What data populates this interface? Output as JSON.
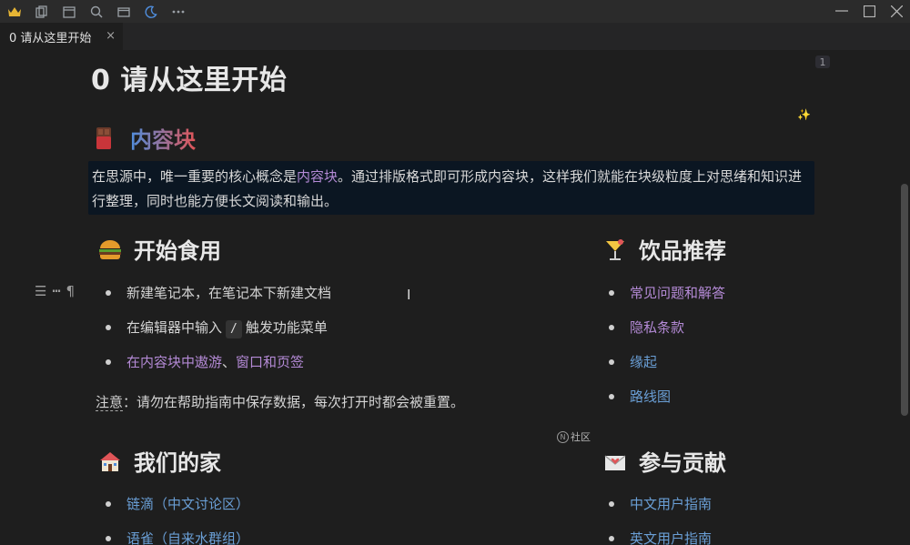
{
  "toolbar": {
    "icons": [
      "crown-icon",
      "copy-icon",
      "calendar-icon",
      "search-icon",
      "window-icon",
      "moon-icon",
      "more-icon"
    ]
  },
  "window_controls": [
    "minimize-icon",
    "maximize-icon",
    "close-icon"
  ],
  "tab": {
    "label": "0 请从这里开始",
    "close": "×"
  },
  "page": {
    "title": "0 请从这里开始",
    "badge": "1"
  },
  "section_content_block": {
    "title": "内容块",
    "quote_before": "在思源中，唯一重要的核心概念是",
    "quote_link": "内容块",
    "quote_after": "。通过排版格式即可形成内容块，这样我们就能在块级粒度上对思绪和知识进行整理，同时也能方便长文阅读和输出。"
  },
  "section_start": {
    "title": "开始食用",
    "item1": "新建笔记本，在笔记本下新建文档",
    "item2_before": "在编辑器中输入",
    "item2_code": "/",
    "item2_after": "触发功能菜单",
    "item3_link1": "在内容块中遨游",
    "item3_sep": "、",
    "item3_link2": "窗口和页签",
    "note_label": "注意",
    "note_text": "：请勿在帮助指南中保存数据，每次打开时都会被重置。"
  },
  "section_drinks": {
    "title": "饮品推荐",
    "items": [
      "常见问题和解答",
      "隐私条款",
      "缘起",
      "路线图"
    ]
  },
  "community_label": "社区",
  "section_home": {
    "title": "我们的家",
    "items": [
      "链滴（中文讨论区）",
      "语雀（自来水群组）"
    ]
  },
  "section_contrib": {
    "title": "参与贡献",
    "items": [
      "中文用户指南",
      "英文用户指南"
    ]
  },
  "gutter_icons": [
    "list-icon",
    "dash-icon",
    "pilcrow-icon"
  ],
  "colors": {
    "accent_purple": "#b48ad6",
    "accent_blue": "#6a9fd6",
    "quote_bg": "#0b1622"
  }
}
